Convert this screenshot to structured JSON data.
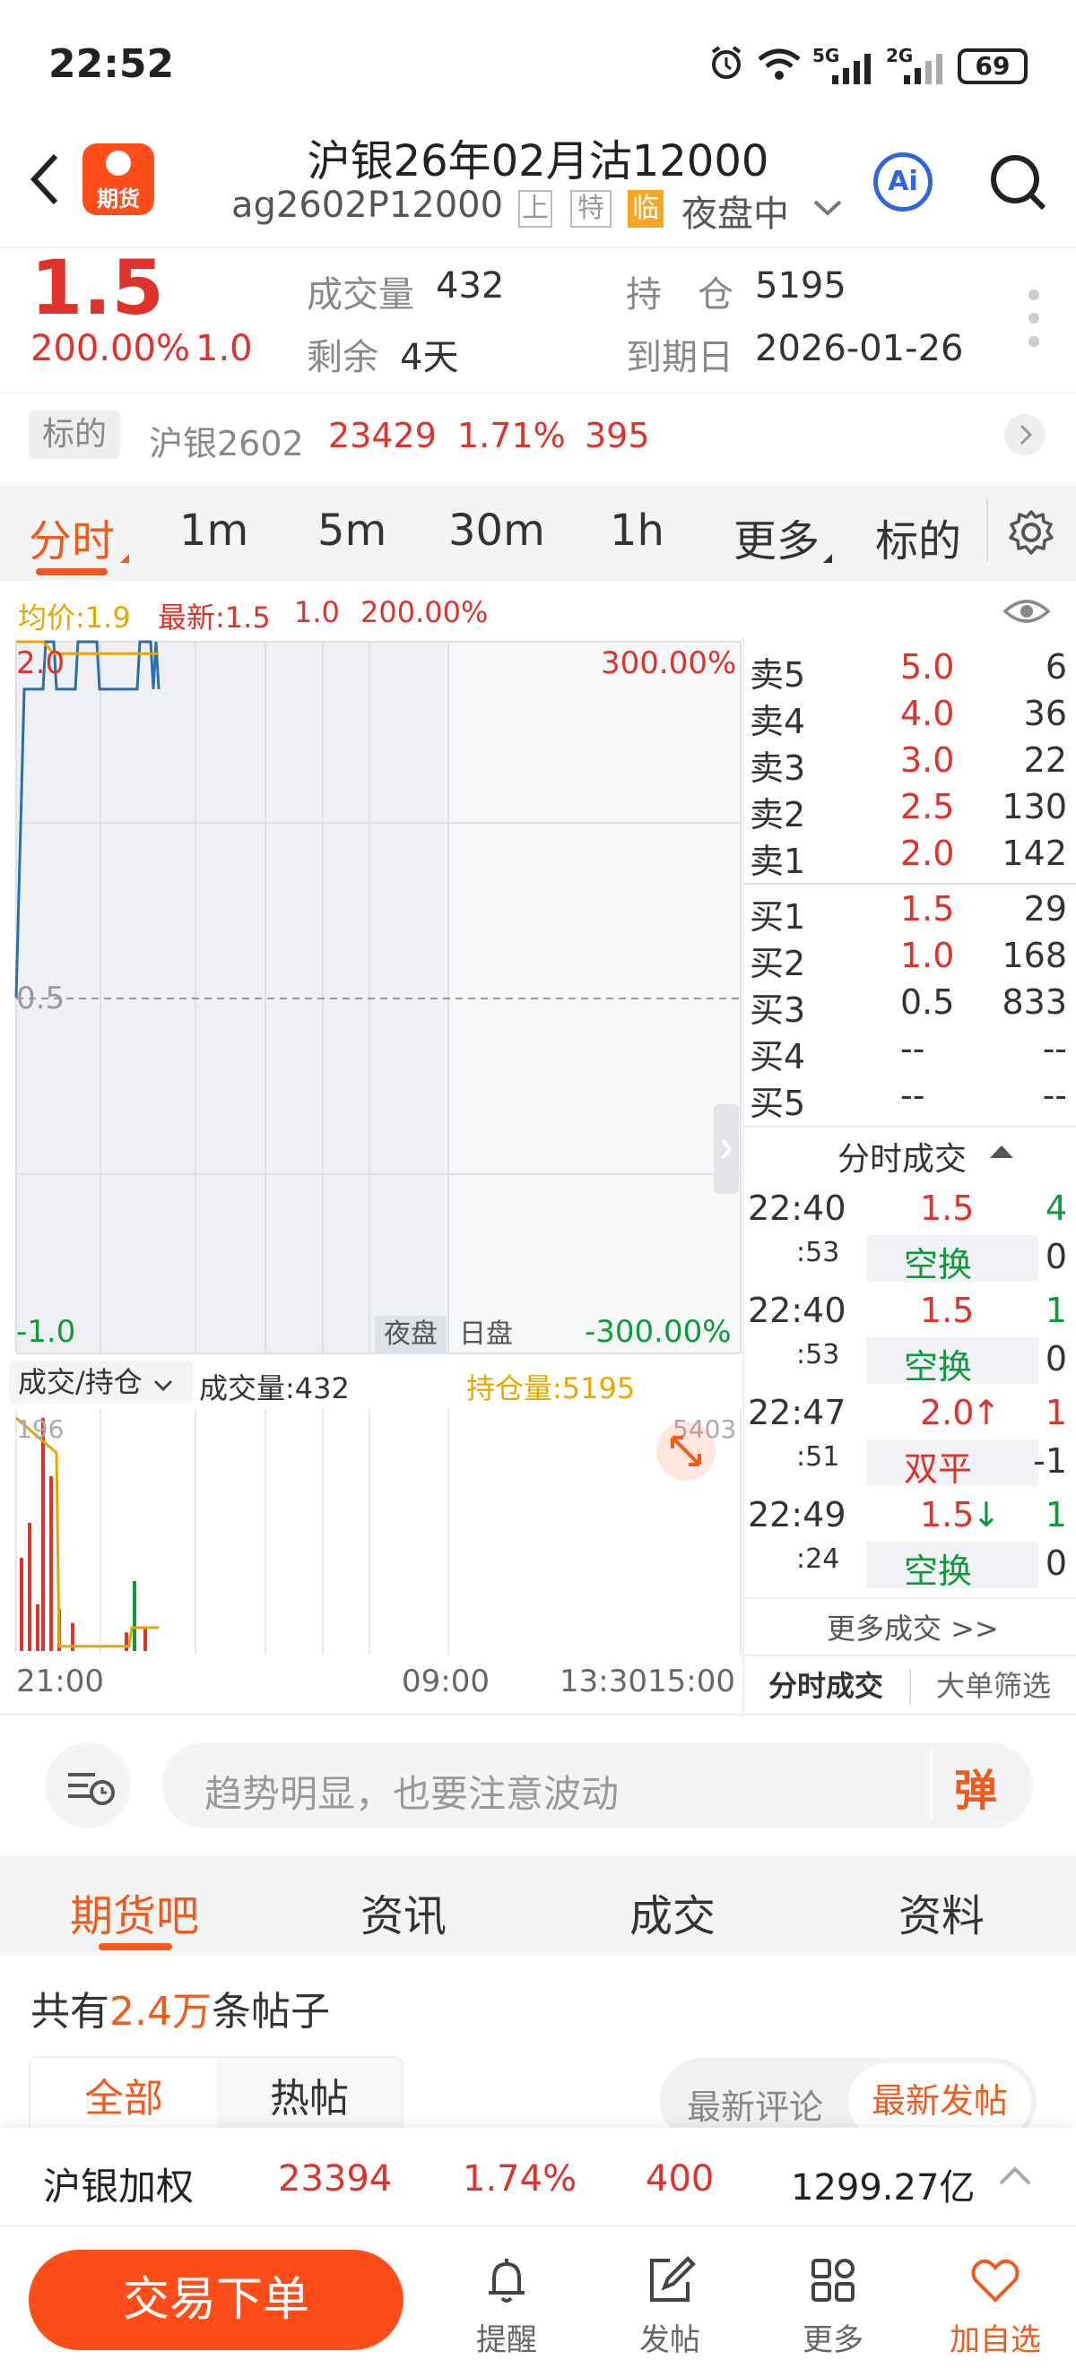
{
  "status": {
    "time": "22:52",
    "battery": "69",
    "net1": "5G",
    "net2": "2G"
  },
  "header": {
    "title": "沪银26年02月沽12000",
    "code": "ag2602P12000",
    "tags": [
      "上",
      "特",
      "临"
    ],
    "session": "夜盘中",
    "logo_text": "期货",
    "ai_label": "Ai"
  },
  "quote": {
    "price": "1.5",
    "change_pct": "200.00%",
    "change": "1.0",
    "volume_label": "成交量",
    "volume": "432",
    "oi_label": "持　仓",
    "oi": "5195",
    "remain_label": "剩余",
    "remain": "4天",
    "expiry_label": "到期日",
    "expiry": "2026-01-26"
  },
  "underlying": {
    "label": "标的",
    "name": "沪银2602",
    "price": "23429",
    "pct": "1.71%",
    "chg": "395"
  },
  "chart_tabs": [
    "分时",
    "1m",
    "5m",
    "30m",
    "1h",
    "更多",
    "标的"
  ],
  "legend": {
    "avg": "均价:1.9",
    "latest": "最新:1.5",
    "chg": "1.0",
    "pct": "200.00%"
  },
  "chart_data": {
    "type": "line",
    "series": [
      {
        "name": "最新",
        "color": "#2a6fb0",
        "values": [
          {
            "t": 0,
            "v": 0.5
          },
          {
            "t": 0.3,
            "v": 1.8
          },
          {
            "t": 0.6,
            "v": 1.8
          },
          {
            "t": 1.0,
            "v": 1.8
          },
          {
            "t": 1.1,
            "v": 2.0
          },
          {
            "t": 1.4,
            "v": 2.0
          },
          {
            "t": 1.5,
            "v": 1.8
          },
          {
            "t": 2.2,
            "v": 1.8
          },
          {
            "t": 2.3,
            "v": 2.0
          },
          {
            "t": 3.0,
            "v": 2.0
          },
          {
            "t": 3.1,
            "v": 1.8
          },
          {
            "t": 4.5,
            "v": 1.8
          },
          {
            "t": 4.6,
            "v": 2.0
          },
          {
            "t": 5.0,
            "v": 2.0
          },
          {
            "t": 5.1,
            "v": 1.8
          },
          {
            "t": 5.2,
            "v": 2.0
          },
          {
            "t": 5.3,
            "v": 1.8
          }
        ]
      },
      {
        "name": "均价",
        "color": "#e6a800",
        "values": [
          {
            "t": 0,
            "v": 2.0
          },
          {
            "t": 1.0,
            "v": 2.0
          },
          {
            "t": 1.4,
            "v": 1.95
          },
          {
            "t": 3.0,
            "v": 1.95
          },
          {
            "t": 5.3,
            "v": 1.95
          }
        ]
      }
    ],
    "price_labels": {
      "top": "2.0",
      "mid": "0.5",
      "bottom": "-1.0"
    },
    "pct_labels": {
      "top": "300.00%",
      "bottom": "-300.00%"
    },
    "ylim": [
      -1.0,
      2.0
    ],
    "session_labels": [
      "夜盘",
      "日盘"
    ],
    "time_labels": [
      "21:00",
      "09:00",
      "13:30",
      "15:00"
    ],
    "volume_panel": {
      "label": "成交/持仓",
      "volume_text": "成交量:432",
      "oi_text": "持仓量:5195",
      "left_label": "196",
      "right_label": "5403",
      "bars": [
        {
          "t": 0.2,
          "v": 40,
          "color": "#e0312a"
        },
        {
          "t": 0.5,
          "v": 55,
          "color": "#e0312a"
        },
        {
          "t": 0.8,
          "v": 20,
          "color": "#e0312a"
        },
        {
          "t": 1.0,
          "v": 100,
          "color": "#e0312a"
        },
        {
          "t": 1.3,
          "v": 75,
          "color": "#e0312a"
        },
        {
          "t": 1.6,
          "v": 18,
          "color": "#e0312a"
        },
        {
          "t": 2.1,
          "v": 12,
          "color": "#e0312a"
        },
        {
          "t": 4.1,
          "v": 8,
          "color": "#e0312a"
        },
        {
          "t": 4.4,
          "v": 30,
          "color": "#0e9a3a"
        },
        {
          "t": 4.8,
          "v": 10,
          "color": "#e0312a"
        }
      ],
      "oi_line": [
        {
          "t": 0,
          "v": 100
        },
        {
          "t": 1.5,
          "v": 85
        },
        {
          "t": 1.6,
          "v": 2
        },
        {
          "t": 4.2,
          "v": 2
        },
        {
          "t": 4.3,
          "v": 10
        },
        {
          "t": 5.3,
          "v": 10
        }
      ]
    }
  },
  "orderbook": {
    "asks": [
      {
        "l": "卖5",
        "p": "5.0",
        "q": "6"
      },
      {
        "l": "卖4",
        "p": "4.0",
        "q": "36"
      },
      {
        "l": "卖3",
        "p": "3.0",
        "q": "22"
      },
      {
        "l": "卖2",
        "p": "2.5",
        "q": "130"
      },
      {
        "l": "卖1",
        "p": "2.0",
        "q": "142"
      }
    ],
    "bids": [
      {
        "l": "买1",
        "p": "1.5",
        "q": "29"
      },
      {
        "l": "买2",
        "p": "1.0",
        "q": "168"
      },
      {
        "l": "买3",
        "p": "0.5",
        "q": "833"
      },
      {
        "l": "买4",
        "p": "--",
        "q": "--"
      },
      {
        "l": "买5",
        "p": "--",
        "q": "--"
      }
    ]
  },
  "ticks": {
    "title": "分时成交",
    "rows": [
      {
        "t1": "22:40",
        "t2": ":53",
        "p": "1.5",
        "arrow": "",
        "q": "4",
        "qcolor": "green",
        "type": "空换",
        "tq": "0"
      },
      {
        "t1": "22:40",
        "t2": ":53",
        "p": "1.5",
        "arrow": "",
        "q": "1",
        "qcolor": "green",
        "type": "空换",
        "tq": "0"
      },
      {
        "t1": "22:47",
        "t2": ":51",
        "p": "2.0",
        "arrow": "↑",
        "q": "1",
        "qcolor": "red",
        "type": "双平",
        "tq": "-1"
      },
      {
        "t1": "22:49",
        "t2": ":24",
        "p": "1.5",
        "arrow": "↓",
        "q": "1",
        "qcolor": "green",
        "type": "空换",
        "tq": "0"
      }
    ],
    "more": "更多成交 >>",
    "tab1": "分时成交",
    "tab2": "大单筛选"
  },
  "comment": {
    "placeholder": "趋势明显，也要注意波动",
    "danmu": "弹"
  },
  "section_tabs": [
    "期货吧",
    "资讯",
    "成交",
    "资料"
  ],
  "posts": {
    "prefix": "共有",
    "count": "2.4万",
    "suffix": "条帖子",
    "filter1": "全部",
    "filter2": "热帖",
    "sort1": "最新评论",
    "sort2": "最新发帖"
  },
  "bottom_ticker": {
    "name": "沪银加权",
    "price": "23394",
    "pct": "1.74%",
    "chg": "400",
    "amount": "1299.27亿"
  },
  "bottom_nav": {
    "trade": "交易下单",
    "items": [
      "提醒",
      "发帖",
      "更多",
      "加自选"
    ]
  }
}
